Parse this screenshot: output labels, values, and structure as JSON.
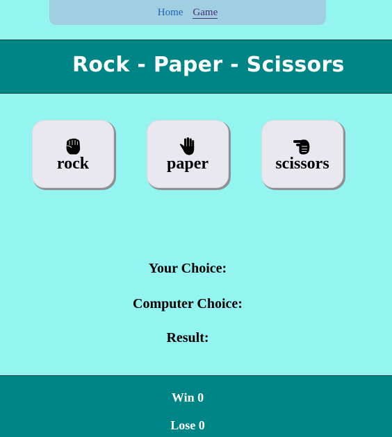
{
  "nav": {
    "items": [
      {
        "label": "Home"
      },
      {
        "label": "Game"
      }
    ],
    "active": "Game"
  },
  "header": {
    "title": "Rock - Paper - Scissors"
  },
  "choices": [
    {
      "label": "rock",
      "icon": "raised-fist-icon"
    },
    {
      "label": "paper",
      "icon": "raised-hand-icon"
    },
    {
      "label": "scissors",
      "icon": "pointing-hand-icon"
    }
  ],
  "status": {
    "your_choice_label": "Your Choice:",
    "computer_choice_label": "Computer Choice:",
    "result_label": "Result:"
  },
  "score": {
    "win_label": "Win 0",
    "lose_label": "Lose 0"
  },
  "colors": {
    "background": "#94f4f0",
    "header": "#008587",
    "nav": "#a0cfe2",
    "button": "#e9e8ee"
  }
}
